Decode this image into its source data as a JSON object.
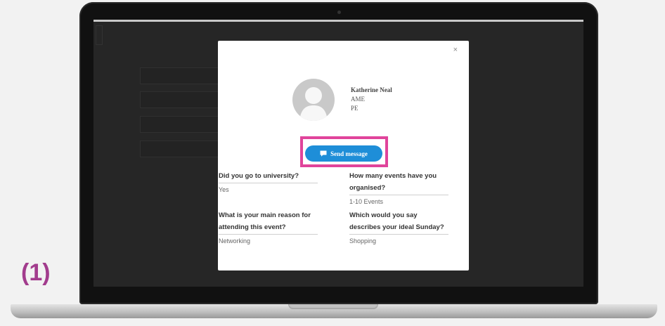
{
  "step": {
    "label": "(1)"
  },
  "modal": {
    "close_glyph": "×",
    "profile": {
      "name": "Katherine Neal",
      "line1": "AME",
      "line2": "PE"
    },
    "send_button": {
      "label": "Send message",
      "icon": "chat-bubble-icon"
    },
    "questions": [
      {
        "q": "Did you go to university?",
        "a": "Yes"
      },
      {
        "q": "How many events have you organised?",
        "a": "1-10 Events"
      },
      {
        "q": "What is your main reason for attending this event?",
        "a": "Networking"
      },
      {
        "q": "Which would you say describes your ideal Sunday?",
        "a": "Shopping"
      }
    ]
  },
  "colors": {
    "accent": "#1e8ed8",
    "highlight": "#e0449b",
    "step_label": "#a23c8d"
  }
}
